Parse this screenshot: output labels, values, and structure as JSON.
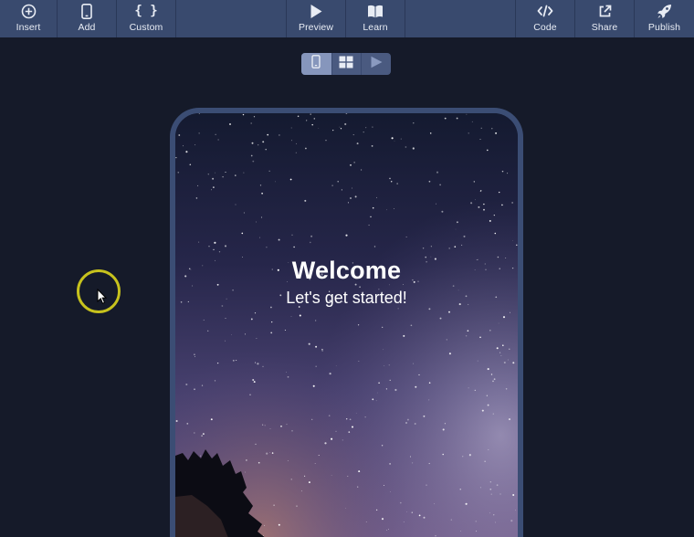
{
  "toolbar": {
    "items": [
      {
        "label": "Insert",
        "icon": "plus-circle-icon"
      },
      {
        "label": "Add",
        "icon": "phone-icon"
      },
      {
        "label": "Custom",
        "icon": "braces-icon"
      },
      {
        "label": "Preview",
        "icon": "play-icon"
      },
      {
        "label": "Learn",
        "icon": "book-icon"
      },
      {
        "label": "Code",
        "icon": "code-icon"
      },
      {
        "label": "Share",
        "icon": "external-link-icon"
      },
      {
        "label": "Publish",
        "icon": "rocket-icon"
      }
    ]
  },
  "view_toggle": {
    "options": [
      "phone-view-icon",
      "grid-view-icon",
      "play-view-icon"
    ],
    "active": "phone-view-icon"
  },
  "preview": {
    "title": "Welcome",
    "subtitle": "Let's get started!"
  },
  "colors": {
    "toolbar_bg": "#394a6e",
    "canvas_bg": "#151a29",
    "phone_frame": "#3b4d74",
    "cursor_ring": "#c7c21d"
  }
}
